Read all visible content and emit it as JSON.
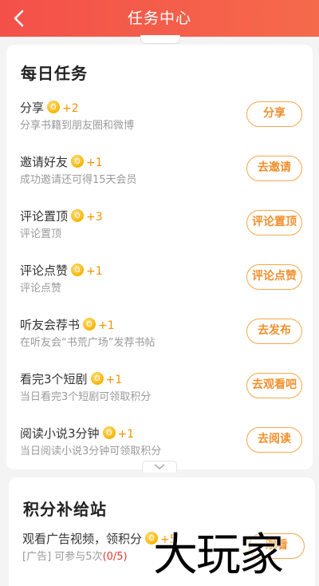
{
  "header": {
    "title": "任务中心",
    "back_icon": "chevron-left-icon"
  },
  "daily": {
    "title": "每日任务",
    "tasks": [
      {
        "name": "分享",
        "points": "+2",
        "desc": "分享书籍到朋友圈和微博",
        "button": "分享"
      },
      {
        "name": "邀请好友",
        "points": "+1",
        "desc": "成功邀请还可得15天会员",
        "button": "去邀请"
      },
      {
        "name": "评论置顶",
        "points": "+3",
        "desc": "评论置顶",
        "button": "评论置顶"
      },
      {
        "name": "评论点赞",
        "points": "+1",
        "desc": "评论点赞",
        "button": "评论点赞"
      },
      {
        "name": "听友会荐书",
        "points": "+1",
        "desc": "在听友会“书荒广场”发荐书帖",
        "button": "去发布"
      },
      {
        "name": "看完3个短剧",
        "points": "+1",
        "desc": "当日看完3个短剧可领取积分",
        "button": "去观看吧"
      },
      {
        "name": "阅读小说3分钟",
        "points": "+1",
        "desc": "当日阅读小说3分钟可领取积分",
        "button": "去阅读"
      }
    ]
  },
  "points_station": {
    "title": "积分补给站",
    "ad_task": {
      "name": "观看广告视频，领积分",
      "points": "+5",
      "desc_prefix": "[广告] 可参与5次",
      "progress": "(0/5)",
      "button": "观看"
    }
  },
  "watermark": "大玩家",
  "colors": {
    "header": "#f4504a",
    "accent": "#f0902e",
    "points": "#f29300"
  }
}
